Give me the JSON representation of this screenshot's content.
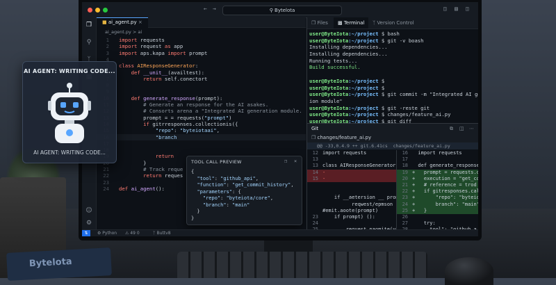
{
  "window": {
    "title": "Bytelota"
  },
  "activity_bar": [
    "files-icon",
    "search-icon",
    "git-branch-icon",
    "extensions-icon",
    "account-icon",
    "settings-icon"
  ],
  "editor": {
    "tab_label": "ai_agent.py",
    "breadcrumb": "ai_agent.py  >  ai",
    "lines": [
      {
        "n": "1",
        "code": [
          [
            "kw",
            "import "
          ],
          [
            "txt",
            "requests"
          ]
        ]
      },
      {
        "n": "2",
        "code": [
          [
            "kw",
            "import "
          ],
          [
            "txt",
            "request "
          ],
          [
            "kw",
            "as "
          ],
          [
            "txt",
            "app"
          ]
        ]
      },
      {
        "n": "3",
        "code": [
          [
            "kw",
            "import "
          ],
          [
            "txt",
            "aps.kapa "
          ],
          [
            "kw",
            "import "
          ],
          [
            "txt",
            "prompt"
          ]
        ]
      },
      {
        "n": "4",
        "code": []
      },
      {
        "n": "5",
        "code": [
          [
            "kw",
            "class "
          ],
          [
            "cls",
            "AIResponseGenerator"
          ],
          [
            "txt",
            ":"
          ]
        ]
      },
      {
        "n": "6",
        "code": [
          [
            "txt",
            "    "
          ],
          [
            "kw",
            "def "
          ],
          [
            "fn",
            "__unit__"
          ],
          [
            "txt",
            "(availtest):"
          ]
        ]
      },
      {
        "n": "7",
        "code": [
          [
            "txt",
            "        "
          ],
          [
            "kw",
            "return "
          ],
          [
            "txt",
            "self.conectort"
          ]
        ]
      },
      {
        "n": "8",
        "code": []
      },
      {
        "n": "9",
        "code": []
      },
      {
        "n": "10",
        "code": [
          [
            "txt",
            "    "
          ],
          [
            "kw",
            "def "
          ],
          [
            "fn",
            "generate_response"
          ],
          [
            "txt",
            "(prompt):"
          ]
        ]
      },
      {
        "n": "11",
        "code": [
          [
            "cm",
            "        # Generate an response for the AI asakes."
          ]
        ]
      },
      {
        "n": "12",
        "code": [
          [
            "cm",
            "        # Consorts arena a \"Integrated AI generation module."
          ]
        ]
      },
      {
        "n": "13",
        "code": [
          [
            "txt",
            "        prompt = = requests("
          ],
          [
            "str",
            "\"prompt\""
          ],
          [
            "txt",
            ")"
          ]
        ]
      },
      {
        "n": "14",
        "code": [
          [
            "txt",
            "        "
          ],
          [
            "kw",
            "if "
          ],
          [
            "txt",
            "gitrresponses.collectionis({"
          ]
        ]
      },
      {
        "n": "15",
        "code": [
          [
            "txt",
            "            "
          ],
          [
            "str",
            "\"repo\""
          ],
          [
            "txt",
            ": "
          ],
          [
            "str",
            "\"byteiotaai\""
          ],
          [
            "txt",
            ","
          ]
        ]
      },
      {
        "n": "16",
        "code": [
          [
            "txt",
            "            "
          ],
          [
            "str",
            "\"branch"
          ]
        ]
      },
      {
        "n": "17",
        "code": []
      },
      {
        "n": "18",
        "code": []
      },
      {
        "n": "19",
        "code": [
          [
            "txt",
            "            "
          ],
          [
            "kw",
            "return"
          ]
        ]
      },
      {
        "n": "20",
        "code": [
          [
            "txt",
            "        }"
          ]
        ]
      },
      {
        "n": "21",
        "code": [
          [
            "cm",
            "        # Track reque"
          ]
        ]
      },
      {
        "n": "22",
        "code": [
          [
            "txt",
            "        "
          ],
          [
            "kw",
            "return "
          ],
          [
            "txt",
            "reques"
          ]
        ]
      },
      {
        "n": "23",
        "code": []
      },
      {
        "n": "24",
        "code": [
          [
            "kw",
            "def "
          ],
          [
            "fn",
            "ai_agent"
          ],
          [
            "txt",
            "():"
          ]
        ]
      }
    ]
  },
  "tooltip": {
    "title": "TOOL CALL PREVIEW",
    "lines": [
      [
        [
          "txt",
          "{"
        ]
      ],
      [
        [
          "txt",
          "  "
        ],
        [
          "str",
          "\"tool\""
        ],
        [
          "txt",
          ": "
        ],
        [
          "str",
          "\"github_api\""
        ],
        [
          "txt",
          ","
        ]
      ],
      [
        [
          "txt",
          "  "
        ],
        [
          "str",
          "\"function\""
        ],
        [
          "txt",
          ": "
        ],
        [
          "str",
          "\"get_commit_history\""
        ],
        [
          "txt",
          ","
        ]
      ],
      [
        [
          "txt",
          "  "
        ],
        [
          "str",
          "\"parameters\""
        ],
        [
          "txt",
          ": {"
        ]
      ],
      [
        [
          "txt",
          "    "
        ],
        [
          "str",
          "\"repo\""
        ],
        [
          "txt",
          ": "
        ],
        [
          "str",
          "\"byteiota/core\""
        ],
        [
          "txt",
          ","
        ]
      ],
      [
        [
          "txt",
          "    "
        ],
        [
          "str",
          "\"branch\""
        ],
        [
          "txt",
          ": "
        ],
        [
          "str",
          "\"main\""
        ]
      ],
      [
        [
          "txt",
          "  }"
        ]
      ],
      [
        [
          "txt",
          "}"
        ]
      ]
    ]
  },
  "right_tabs": [
    "Files",
    "Terminal",
    "Version Control"
  ],
  "terminal": {
    "lines": [
      {
        "prompt": "user@ByteIota",
        "path": ":~/project",
        "cmd": " $ bash"
      },
      {
        "prompt": "user@ByteIota",
        "path": ":~/project",
        "cmd": " $ git -v boash"
      },
      {
        "plain": "Installing dependencies..."
      },
      {
        "plain": "Installing dependencies..."
      },
      {
        "plain": "Running tests..."
      },
      {
        "ok": "Build successful."
      },
      {
        "plain": ""
      },
      {
        "prompt": "user@ByteIota",
        "path": ":~/project",
        "cmd": " $"
      },
      {
        "prompt": "user@ByteIota",
        "path": ":~/project",
        "cmd": " $"
      },
      {
        "prompt": "user@ByteIota",
        "path": ":~/project",
        "cmd": " $ git commit -m \"Integrated AI generat"
      },
      {
        "plain": "ion module\""
      },
      {
        "prompt": "user@ByteIota",
        "path": ":~/project",
        "cmd": " $ git -reste git"
      },
      {
        "prompt": "user@ByteIota",
        "path": ":~/project",
        "cmd": " $ changes/feature_ai.py"
      },
      {
        "prompt": "user@ByteIota",
        "path": ":~/project",
        "cmd": " $ git diff"
      },
      {
        "prompt": "user@ByteIota",
        "path": ":~/project",
        "cmd": " $ ",
        "cursor": true
      }
    ]
  },
  "git": {
    "title": "Git",
    "file": "changes/feature_ai.py",
    "hunk": "@@ -33,0.4.9 ++ git.6.41cs  changes/feature_ai.py",
    "left": [
      {
        "n": "12",
        "t": "import requests",
        "k": ""
      },
      {
        "n": "13",
        "t": "",
        "k": ""
      },
      {
        "n": "13",
        "t": "class AIResponseGenerator:",
        "k": ""
      },
      {
        "n": "14",
        "t": "-",
        "k": "del"
      },
      {
        "n": "15",
        "t": "-",
        "k": "del"
      },
      {
        "n": "",
        "t": "",
        "k": ""
      },
      {
        "n": "",
        "t": "",
        "k": ""
      },
      {
        "n": "",
        "t": "    if __aetersion __ prom",
        "k": ""
      },
      {
        "n": "",
        "t": "          reqwest/epmson",
        "k": ""
      },
      {
        "n": "",
        "t": "#emit.aoote(prompt)",
        "k": ""
      },
      {
        "n": "23",
        "t": "    if prompt) ():",
        "k": ""
      },
      {
        "n": "24",
        "t": "",
        "k": ""
      },
      {
        "n": "25",
        "t": "        request.paomite(ve",
        "k": ""
      }
    ],
    "right": [
      {
        "n": "16",
        "t": "  import requests",
        "k": ""
      },
      {
        "n": "17",
        "t": "",
        "k": ""
      },
      {
        "n": "18",
        "t": "  def generate_response(p",
        "k": ""
      },
      {
        "n": "19",
        "t": "+   prompt = requests.o",
        "k": "add"
      },
      {
        "n": "20",
        "t": "+   execution = \"get_co",
        "k": "add"
      },
      {
        "n": "21",
        "t": "+   # reference = trod",
        "k": "add"
      },
      {
        "n": "22",
        "t": "+   if gitresponses.cal",
        "k": "add"
      },
      {
        "n": "23",
        "t": "+       \"repo\": \"byteio",
        "k": "add"
      },
      {
        "n": "24",
        "t": "+       branch\": \"main\"",
        "k": "add"
      },
      {
        "n": "25",
        "t": "+   }",
        "k": "add"
      },
      {
        "n": "26",
        "t": "",
        "k": ""
      },
      {
        "n": "27",
        "t": "    try:",
        "k": ""
      },
      {
        "n": "28",
        "t": "      tool\": \"github_a",
        "k": ""
      }
    ]
  },
  "statusbar": {
    "lang": "Python",
    "problems": "49 0",
    "branch": "Buttv8"
  },
  "ai_card": {
    "heading": "AI AGENT: WRITING CODE...",
    "caption": "AI AGENT: WRITING CODE..."
  },
  "notebook": {
    "brand": "Bytelota"
  },
  "colors": {
    "accent": "#58a6ff",
    "prompt_green": "#7ee787",
    "path_blue": "#79c0ff",
    "deletion_red": "#5a1e24",
    "addition_green": "#1f4a2a"
  }
}
